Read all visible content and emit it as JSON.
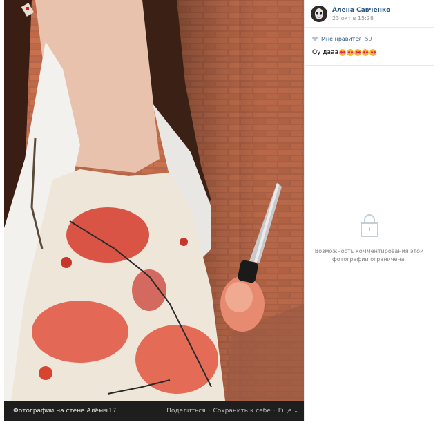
{
  "post": {
    "author_name": "Алена Савченко",
    "date": "23 окт в 15:28",
    "like_label": "Мне нравится",
    "like_count": "59",
    "caption": "Оу дааа",
    "caption_emoji": [
      "heart-eyes-emoji",
      "heart-eyes-emoji",
      "heart-eyes-emoji",
      "heart-eyes-emoji",
      "heart-eyes-emoji"
    ],
    "comments_restricted_line1": "Возможность комментирования этой",
    "comments_restricted_line2": "фотографии ограничена."
  },
  "footer": {
    "album_title": "Фотографии на стене Алены",
    "counter": "7 из 17",
    "share_label": "Поделиться",
    "save_label": "Сохранить к себе",
    "more_label": "Ещё"
  },
  "colors": {
    "link": "#2a5885",
    "footer_bg": "#1e1e1e",
    "muted": "#939393"
  },
  "icons": [
    "heart-icon",
    "lock-icon",
    "chevron-down-icon"
  ]
}
